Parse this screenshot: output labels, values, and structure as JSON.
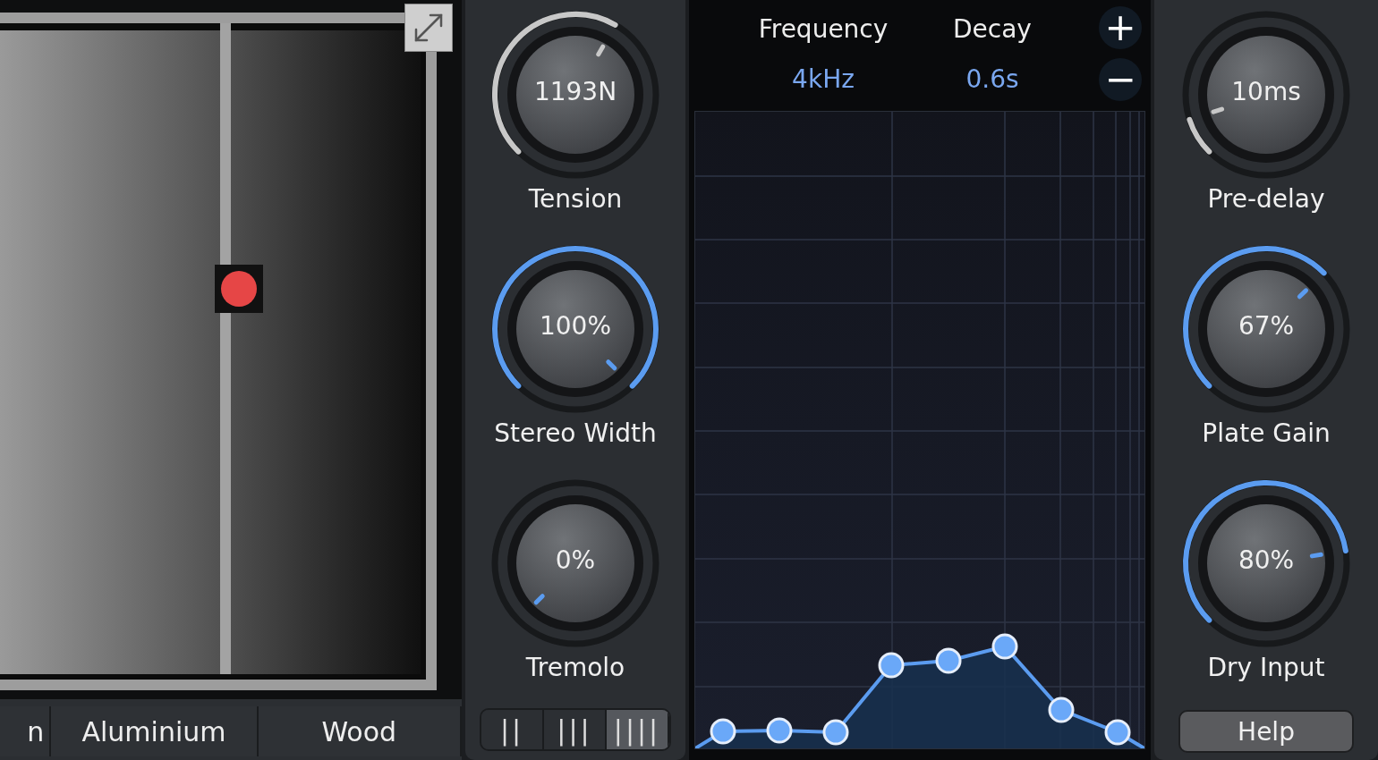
{
  "plate": {
    "materials": [
      {
        "label": "n",
        "selected": false
      },
      {
        "label": "Aluminium",
        "selected": false
      },
      {
        "label": "Wood",
        "selected": false
      }
    ]
  },
  "knobs_left": [
    {
      "label": "Tension",
      "value": "1193N"
    },
    {
      "label": "Stereo Width",
      "value": "100%"
    },
    {
      "label": "Tremolo",
      "value": "0%"
    }
  ],
  "voices": [
    {
      "label": "||",
      "selected": false
    },
    {
      "label": "|||",
      "selected": false
    },
    {
      "label": "||||",
      "selected": true
    }
  ],
  "filter": {
    "columns": [
      {
        "label": "Frequency",
        "value": "4kHz"
      },
      {
        "label": "Decay",
        "value": "0.6s"
      }
    ],
    "buttons": [
      "+",
      "−"
    ]
  },
  "knobs_right": [
    {
      "label": "Pre-delay",
      "value": "10ms"
    },
    {
      "label": "Plate Gain",
      "value": "67%"
    },
    {
      "label": "Dry Input",
      "value": "80%"
    }
  ],
  "help_button": "Help"
}
